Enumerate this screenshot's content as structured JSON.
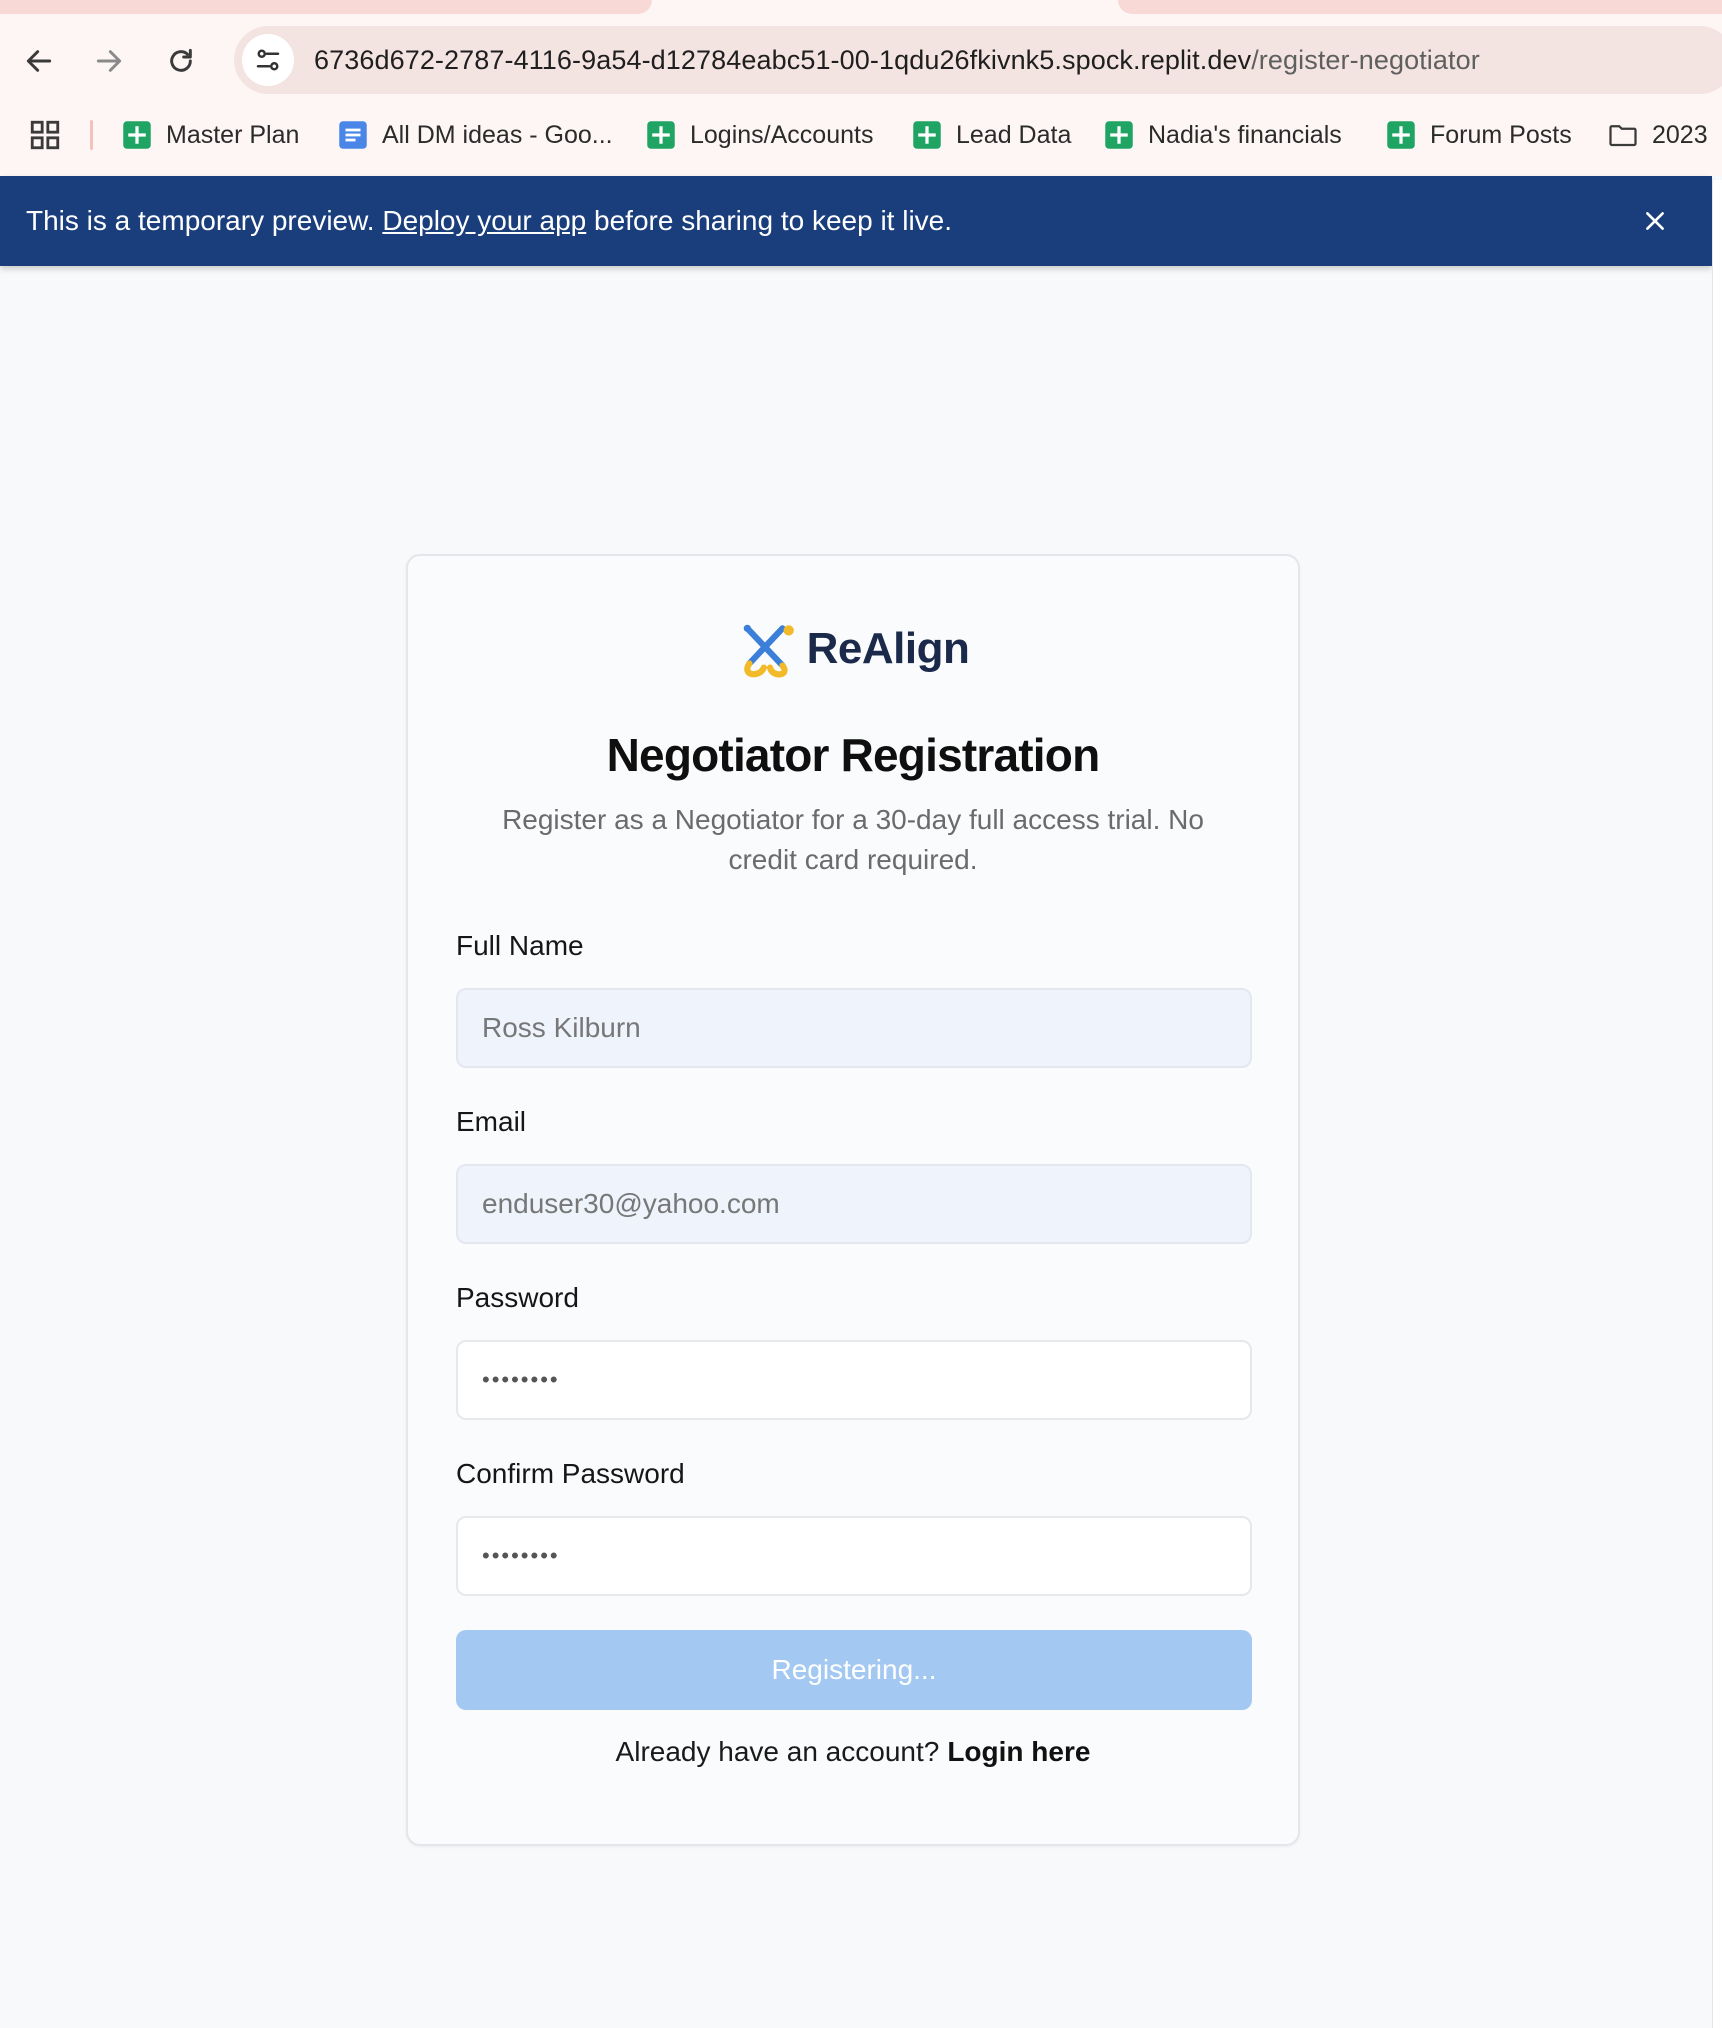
{
  "browser": {
    "url_host": "6736d672-2787-4116-9a54-d12784eabc51-00-1qdu26fkivnk5.spock.replit.dev",
    "url_path": "/register-negotiator",
    "bookmarks": [
      {
        "label": "Master Plan",
        "icon": "sheets-icon"
      },
      {
        "label": "All DM ideas - Goo...",
        "icon": "docs-icon"
      },
      {
        "label": "Logins/Accounts",
        "icon": "sheets-icon"
      },
      {
        "label": "Lead Data",
        "icon": "sheets-icon"
      },
      {
        "label": "Nadia's financials",
        "icon": "sheets-icon"
      },
      {
        "label": "Forum Posts",
        "icon": "sheets-icon"
      },
      {
        "label": "2023",
        "icon": "folder-icon"
      }
    ]
  },
  "banner": {
    "prefix": "This is a temporary preview. ",
    "link": "Deploy your app",
    "suffix": " before sharing to keep it live."
  },
  "brand": {
    "name": "ReAlign",
    "colors": {
      "blue": "#3b7fd9",
      "yellow": "#f2b928",
      "navy": "#1b2a4a"
    }
  },
  "form": {
    "title": "Negotiator Registration",
    "subtitle": "Register as a Negotiator for a 30-day full access trial. No credit card required.",
    "full_name_label": "Full Name",
    "full_name_value": "Ross Kilburn",
    "email_label": "Email",
    "email_value": "enduser30@yahoo.com",
    "password_label": "Password",
    "password_value": "••••••••",
    "confirm_label": "Confirm Password",
    "confirm_value": "••••••••",
    "submit_label": "Registering...",
    "login_prompt": "Already have an account?",
    "login_link": "Login here"
  },
  "colors": {
    "banner_bg": "#1a3e7c",
    "button_disabled": "#a3c8f2",
    "filled_input_bg": "#eef3fc"
  }
}
